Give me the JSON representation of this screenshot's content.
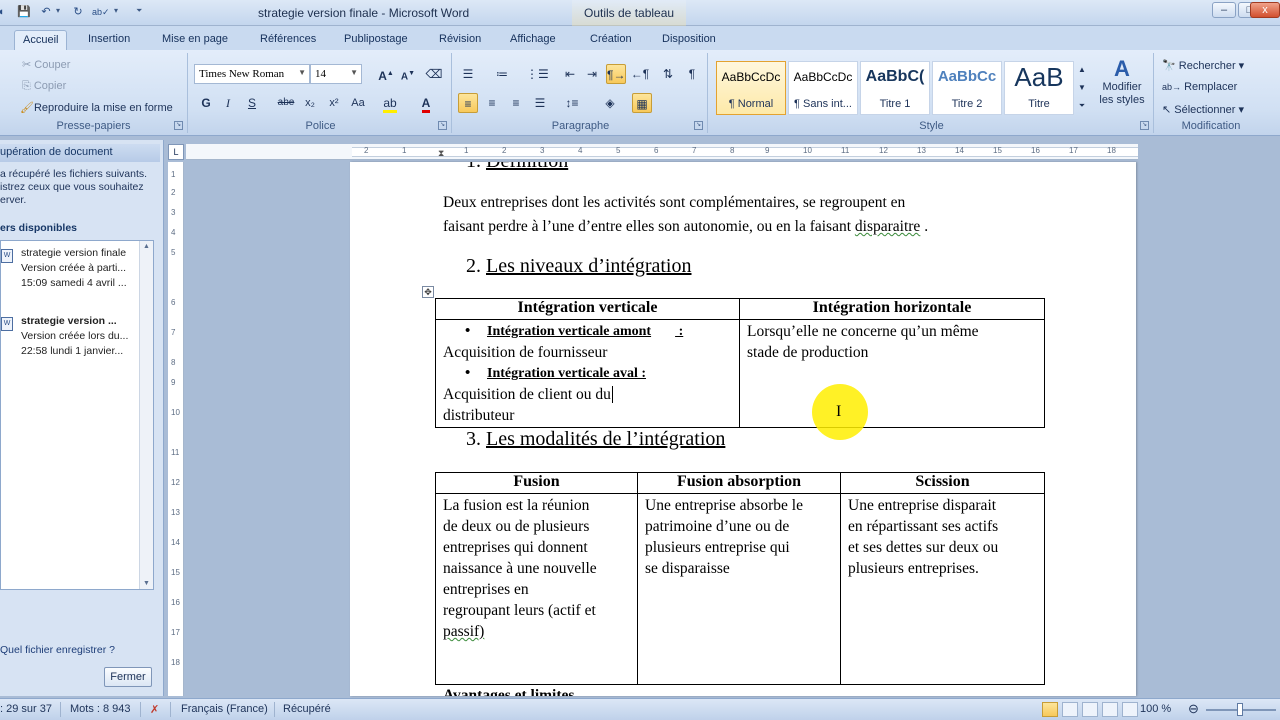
{
  "window": {
    "title": "strategie version finale - Microsoft Word",
    "context_tab_title": "Outils de tableau",
    "buttons": {
      "minimize": "–",
      "maximize": "□",
      "close": "x"
    }
  },
  "quick_access": {
    "items": [
      "save-icon",
      "undo-icon",
      "redo-icon",
      "spelling-icon",
      "customize-icon"
    ]
  },
  "ribbon_tabs": [
    {
      "label": "Accueil",
      "active": true
    },
    {
      "label": "Insertion"
    },
    {
      "label": "Mise en page"
    },
    {
      "label": "Références"
    },
    {
      "label": "Publipostage"
    },
    {
      "label": "Révision"
    },
    {
      "label": "Affichage"
    },
    {
      "label": "Création",
      "contextual": true
    },
    {
      "label": "Disposition",
      "contextual": true
    }
  ],
  "ribbon": {
    "clipboard": {
      "label": "Presse-papiers",
      "cut": "Couper",
      "copy": "Copier",
      "format_painter": "Reproduire la mise en forme"
    },
    "font": {
      "label": "Police",
      "family": "Times New Roman",
      "size": "14",
      "bold": "G",
      "italic": "I",
      "underline": "S",
      "strike": "abe",
      "subscript": "x₂",
      "superscript": "x²",
      "case": "Aa"
    },
    "paragraph": {
      "label": "Paragraphe"
    },
    "styles": {
      "label": "Style",
      "items": [
        {
          "sample": "AaBbCcDc",
          "name": "¶ Normal",
          "selected": true
        },
        {
          "sample": "AaBbCcDc",
          "name": "¶ Sans int..."
        },
        {
          "sample": "AaBbC(",
          "name": "Titre 1"
        },
        {
          "sample": "AaBbCc",
          "name": "Titre 2"
        },
        {
          "sample": "AaB",
          "name": "Titre"
        }
      ],
      "change_styles": "Modifier les styles"
    },
    "editing": {
      "label": "Modification",
      "find": "Rechercher",
      "replace": "Remplacer",
      "select": "Sélectionner"
    }
  },
  "recovery_pane": {
    "header": "upération de document",
    "desc": [
      "a récupéré les fichiers suivants.",
      "istrez ceux que vous souhaitez",
      "erver."
    ],
    "files_label": "ers disponibles",
    "files": [
      {
        "name": "strategie version finale",
        "info": "Version créée à parti...",
        "date": "15:09 samedi 4 avril ...",
        "bold": false
      },
      {
        "name": "strategie version ...",
        "info": "Version créée lors du...",
        "date": "22:58 lundi 1 janvier...",
        "bold": true
      }
    ],
    "help": "Quel fichier enregistrer ?",
    "close": "Fermer"
  },
  "ruler": {
    "numbers": [
      "2",
      "1",
      "1",
      "2",
      "3",
      "4",
      "5",
      "6",
      "7",
      "8",
      "9",
      "10",
      "11",
      "12",
      "13",
      "14",
      "15",
      "16",
      "17",
      "18"
    ]
  },
  "vruler": {
    "numbers": [
      "1",
      "2",
      "3",
      "4",
      "5",
      "6",
      "7",
      "8",
      "9",
      "10",
      "11",
      "12",
      "13",
      "14",
      "15",
      "16",
      "17",
      "18"
    ]
  },
  "document": {
    "heading1": {
      "num": "1.",
      "text": "Définition"
    },
    "definition": [
      "Deux entreprises dont les activités sont complémentaires, se regroupent en",
      "faisant perdre à l’une d’entre elles son autonomie, ou en la faisant "
    ],
    "definition_squiggle": "disparaitre",
    "definition_end": " .",
    "heading2": {
      "num": "2.",
      "text": "Les  niveaux d’intégration"
    },
    "table1": {
      "headers": [
        "Intégration verticale",
        "Intégration horizontale"
      ],
      "col1": [
        {
          "bullet": "Intégration verticale  amont",
          "colon": " :"
        },
        {
          "text": "Acquisition de fournisseur"
        },
        {
          "bullet": "Intégration  verticale  aval :",
          "colon": ""
        },
        {
          "text": "Acquisition de client  ou du"
        },
        {
          "text": "distributeur"
        }
      ],
      "col2": [
        "Lorsqu’elle ne concerne qu’un même",
        "stade de production"
      ]
    },
    "heading3": {
      "num": "3.",
      "text": "Les modalités de l’intégration"
    },
    "table2": {
      "headers": [
        "Fusion",
        "Fusion absorption",
        "Scission"
      ],
      "cells": [
        [
          "La fusion est la réunion",
          "de deux ou de plusieurs",
          "entreprises  qui donnent",
          "naissance à une nouvelle",
          "entreprises   en",
          "regroupant leurs (actif et",
          "passif)"
        ],
        [
          "Une entreprise absorbe le",
          "patrimoine d’une ou  de",
          "plusieurs entreprise qui",
          "se disparaisse"
        ],
        [
          "Une entreprise  disparait",
          "en répartissant ses actifs",
          "et ses dettes  sur  deux ou",
          "plusieurs entreprises."
        ]
      ]
    },
    "cutoff_heading": "Avantages et limites"
  },
  "status_bar": {
    "page": ": 29 sur 37",
    "words": "Mots : 8 943",
    "language": "Français (France)",
    "state": "Récupéré",
    "zoom": "100 %"
  }
}
